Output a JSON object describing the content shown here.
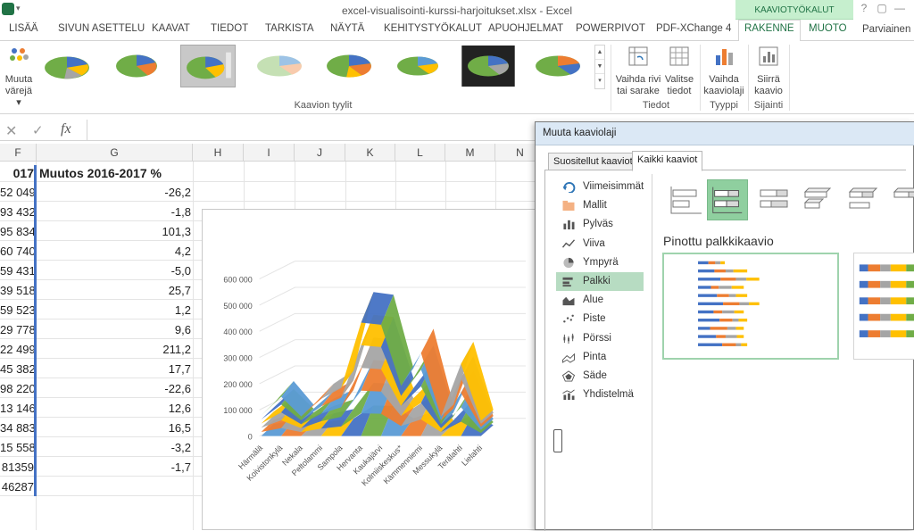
{
  "window": {
    "title": "excel-visualisointi-kurssi-harjoitukset.xlsx - Excel",
    "context_group": "KAAVIOTYÖKALUT",
    "controls": [
      "?",
      "▢",
      "—"
    ]
  },
  "tabs": [
    {
      "label": "LISÄÄ"
    },
    {
      "label": "SIVUN ASETTELU"
    },
    {
      "label": "KAAVAT"
    },
    {
      "label": "TIEDOT"
    },
    {
      "label": "TARKISTA"
    },
    {
      "label": "NÄYTÄ"
    },
    {
      "label": "KEHITYSTYÖKALUT"
    },
    {
      "label": "APUOHJELMAT"
    },
    {
      "label": "POWERPIVOT"
    },
    {
      "label": "PDF-XChange 4"
    },
    {
      "label": "RAKENNE"
    },
    {
      "label": "MUOTO"
    }
  ],
  "user": "Parviainen L",
  "ribbon": {
    "change_colors": "Muuta\nvärejä",
    "change_colors_l1": "Muuta",
    "change_colors_l2": "värejä ▾",
    "styles_group": "Kaavion tyylit",
    "switch_row_col_l1": "Vaihda rivi",
    "switch_row_col_l2": "tai sarake",
    "select_data_l1": "Valitse",
    "select_data_l2": "tiedot",
    "data_group": "Tiedot",
    "change_type_l1": "Vaihda",
    "change_type_l2": "kaaviolaji",
    "type_group": "Tyyppi",
    "move_chart_l1": "Siirrä",
    "move_chart_l2": "kaavio",
    "location_group": "Sijainti"
  },
  "formula_bar": {
    "cancel": "✕",
    "enter": "✓",
    "fx": "fx",
    "value": ""
  },
  "columns": [
    "F",
    "G",
    "H",
    "I",
    "J",
    "K",
    "L",
    "M",
    "N"
  ],
  "sheet": {
    "header_f": "017",
    "header_g": "Muutos 2016-2017 %",
    "rows": [
      {
        "f": "52 049",
        "g": "-26,2"
      },
      {
        "f": "93 432",
        "g": "-1,8"
      },
      {
        "f": "95 834",
        "g": "101,3"
      },
      {
        "f": "60 740",
        "g": "4,2"
      },
      {
        "f": "59 431",
        "g": "-5,0"
      },
      {
        "f": "39 518",
        "g": "25,7"
      },
      {
        "f": "59 523",
        "g": "1,2"
      },
      {
        "f": "29 778",
        "g": "9,6"
      },
      {
        "f": "22 499",
        "g": "211,2"
      },
      {
        "f": "45 382",
        "g": "17,7"
      },
      {
        "f": "98 220",
        "g": "-22,6"
      },
      {
        "f": "13 146",
        "g": "12,6"
      },
      {
        "f": "34 883",
        "g": "16,5"
      },
      {
        "f": "15 558",
        "g": "-3,2"
      },
      {
        "f": "81359",
        "g": "-1,7"
      },
      {
        "f": "46287",
        "g": ""
      }
    ]
  },
  "chart_data": {
    "type": "area",
    "title": "",
    "xlabel": "",
    "ylabel": "",
    "ylim": [
      0,
      600000
    ],
    "y_ticks": [
      "0",
      "100 000",
      "200 000",
      "300 000",
      "400 000",
      "500 000",
      "600 000"
    ],
    "categories": [
      "Härmälä",
      "Koivistonkylä",
      "Nekala",
      "Peltolammi",
      "Sampola",
      "Hervanta",
      "Kaukajärvi",
      "Kolmiiskeskus*",
      "Kämmenniemi",
      "Messukylä",
      "Terälahti",
      "Lielahti"
    ],
    "values": [
      95000,
      180000,
      90000,
      170000,
      220000,
      520000,
      510000,
      230000,
      380000,
      90000,
      330000,
      70000
    ],
    "colors": [
      "#5b9bd5",
      "#ed7d31",
      "#a5a5a5",
      "#ffc000",
      "#4472c4",
      "#70ad47"
    ]
  },
  "dialog": {
    "title": "Muuta kaaviolaji",
    "tabs": [
      "Suositellut kaaviot",
      "Kaikki kaaviot"
    ],
    "types": [
      {
        "label": "Viimeisimmät",
        "icon": "recent-icon"
      },
      {
        "label": "Mallit",
        "icon": "templates-folder-icon"
      },
      {
        "label": "Pylväs",
        "icon": "column-chart-icon"
      },
      {
        "label": "Viiva",
        "icon": "line-chart-icon"
      },
      {
        "label": "Ympyrä",
        "icon": "pie-chart-icon"
      },
      {
        "label": "Palkki",
        "icon": "bar-chart-icon"
      },
      {
        "label": "Alue",
        "icon": "area-chart-icon"
      },
      {
        "label": "Piste",
        "icon": "scatter-chart-icon"
      },
      {
        "label": "Pörssi",
        "icon": "stock-chart-icon"
      },
      {
        "label": "Pinta",
        "icon": "surface-chart-icon"
      },
      {
        "label": "Säde",
        "icon": "radar-chart-icon"
      },
      {
        "label": "Yhdistelmä",
        "icon": "combo-chart-icon"
      }
    ],
    "selected_type": "Palkki",
    "subtype_title": "Pinottu palkkikaavio"
  }
}
